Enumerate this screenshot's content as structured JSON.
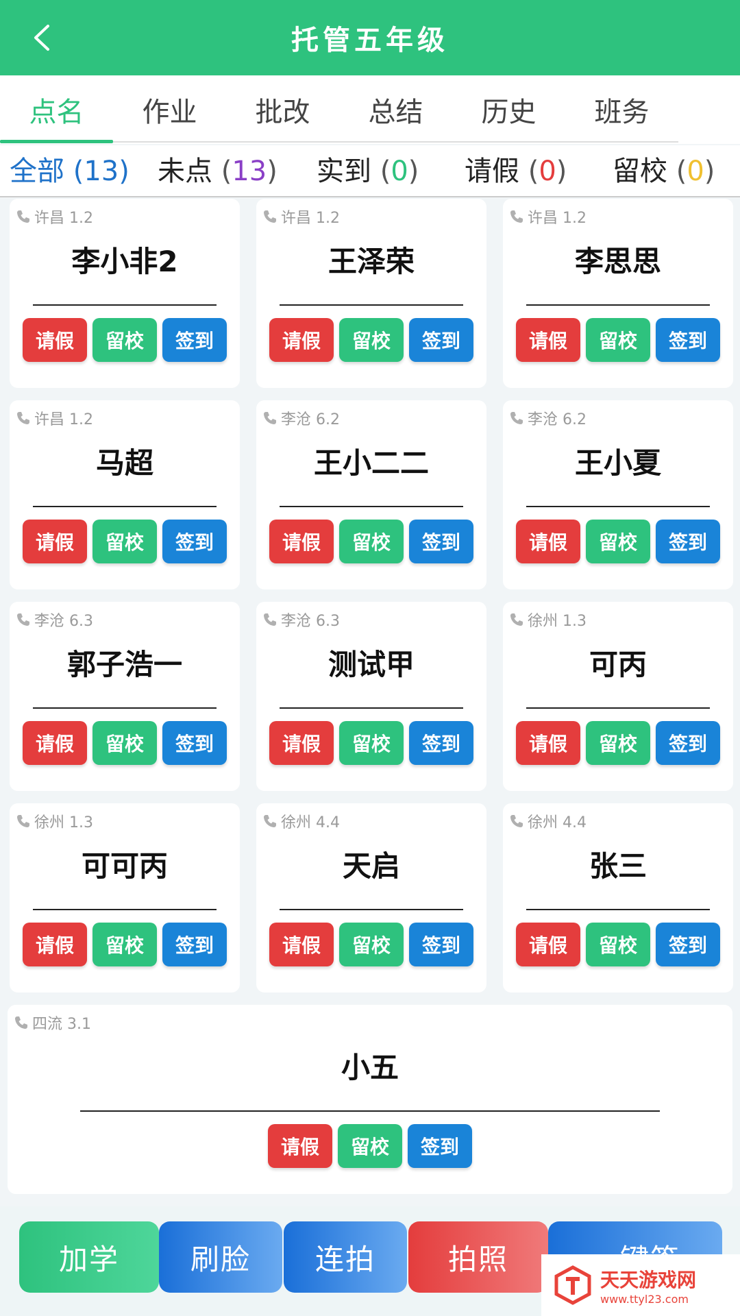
{
  "header": {
    "title": "托管五年级"
  },
  "tabs": [
    {
      "label": "点名"
    },
    {
      "label": "作业"
    },
    {
      "label": "批改"
    },
    {
      "label": "总结"
    },
    {
      "label": "历史"
    },
    {
      "label": "班务"
    }
  ],
  "filters": [
    {
      "label": "全部",
      "count": "13",
      "color": "#1f72c9"
    },
    {
      "label": "未点",
      "count": "13",
      "color": "#8a3fc6"
    },
    {
      "label": "实到",
      "count": "0",
      "color": "#2ec27e"
    },
    {
      "label": "请假",
      "count": "0",
      "color": "#e43d3d"
    },
    {
      "label": "留校",
      "count": "0",
      "color": "#f0c030"
    }
  ],
  "students": [
    {
      "meta": "许昌 1.2",
      "name": "李小非2"
    },
    {
      "meta": "许昌 1.2",
      "name": "王泽荣"
    },
    {
      "meta": "许昌 1.2",
      "name": "李思思"
    },
    {
      "meta": "许昌 1.2",
      "name": "马超"
    },
    {
      "meta": "李沧 6.2",
      "name": "王小二二"
    },
    {
      "meta": "李沧 6.2",
      "name": "王小夏"
    },
    {
      "meta": "李沧 6.3",
      "name": "郭子浩一"
    },
    {
      "meta": "李沧 6.3",
      "name": "测试甲"
    },
    {
      "meta": "徐州 1.3",
      "name": "可丙"
    },
    {
      "meta": "徐州 1.3",
      "name": "可可丙"
    },
    {
      "meta": "徐州 4.4",
      "name": "天启"
    },
    {
      "meta": "徐州 4.4",
      "name": "张三"
    },
    {
      "meta": "四流 3.1",
      "name": "小五"
    }
  ],
  "card_buttons": {
    "leave": "请假",
    "stay": "留校",
    "sign": "签到"
  },
  "bottom_bar": [
    {
      "label": "加学"
    },
    {
      "label": "刷脸"
    },
    {
      "label": "连拍"
    },
    {
      "label": "拍照"
    },
    {
      "label": "一键签"
    }
  ],
  "watermark": {
    "title": "天天游戏网",
    "url": "www.ttyl23.com"
  },
  "colors": {
    "primary": "#2ec27e",
    "leave": "#e43d3d",
    "sign": "#1a84d8"
  }
}
